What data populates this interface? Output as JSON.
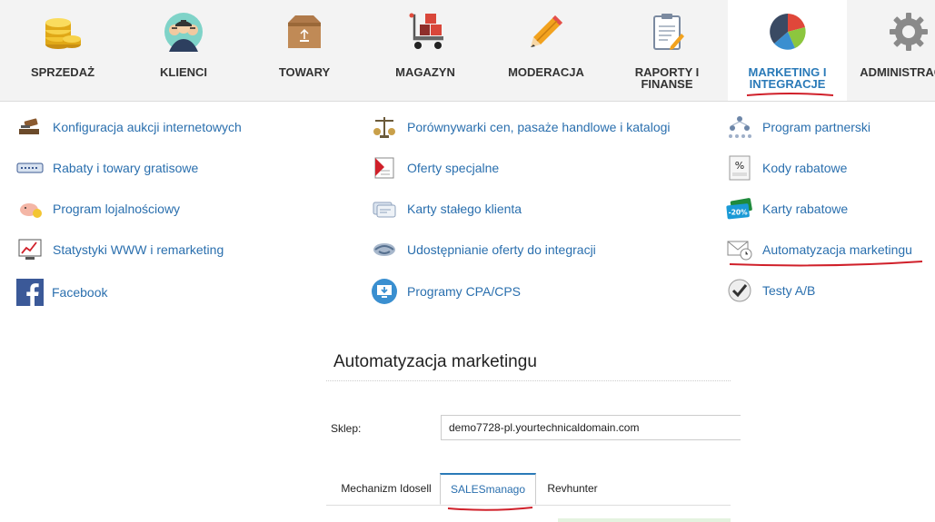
{
  "topnav": {
    "items": [
      {
        "label": "SPRZEDAŻ",
        "icon": "coins-icon"
      },
      {
        "label": "KLIENCI",
        "icon": "people-icon"
      },
      {
        "label": "TOWARY",
        "icon": "box-icon"
      },
      {
        "label": "MAGAZYN",
        "icon": "hand-truck-icon"
      },
      {
        "label": "MODERACJA",
        "icon": "pencil-icon"
      },
      {
        "label_line1": "RAPORTY I",
        "label_line2": "FINANSE",
        "icon": "clipboard-icon"
      },
      {
        "label_line1": "MARKETING I",
        "label_line2": "INTEGRACJE",
        "icon": "pie-chart-icon",
        "active": true
      },
      {
        "label": "ADMINISTRACJA",
        "icon": "gear-icon"
      }
    ]
  },
  "megamenu": {
    "col1": [
      {
        "label": "Konfiguracja aukcji internetowych",
        "icon": "gavel-icon"
      },
      {
        "label": "Rabaty i towary gratisowe",
        "icon": "discount-tag-icon"
      },
      {
        "label": "Program lojalnościowy",
        "icon": "piggy-bank-icon"
      },
      {
        "label": "Statystyki WWW i remarketing",
        "icon": "stats-chart-icon"
      },
      {
        "label": "Facebook",
        "icon": "facebook-icon"
      }
    ],
    "col2": [
      {
        "label": "Porównywarki cen, pasaże handlowe i katalogi",
        "icon": "scales-icon"
      },
      {
        "label": "Oferty specjalne",
        "icon": "special-offer-icon"
      },
      {
        "label": "Karty stałego klienta",
        "icon": "customer-cards-icon"
      },
      {
        "label": "Udostępnianie oferty do integracji",
        "icon": "handshake-icon"
      },
      {
        "label": "Programy CPA/CPS",
        "icon": "cpa-monitor-icon"
      }
    ],
    "col3": [
      {
        "label": "Program partnerski",
        "icon": "partner-network-icon"
      },
      {
        "label": "Kody rabatowe",
        "icon": "percent-code-icon"
      },
      {
        "label": "Karty rabatowe",
        "icon": "discount-card-icon",
        "badge": "-20%"
      },
      {
        "label": "Automatyzacja marketingu",
        "icon": "envelope-clock-icon"
      },
      {
        "label": "Testy A/B",
        "icon": "checkmark-icon"
      }
    ]
  },
  "panel": {
    "title": "Automatyzacja marketingu",
    "shop_label": "Sklep:",
    "shop_value": "demo7728-pl.yourtechnicaldomain.com",
    "tabs": [
      "Mechanizm Idosell",
      "SALESmanago",
      "Revhunter"
    ],
    "active_tab": "SALESmanago"
  },
  "colors": {
    "accent": "#2a7ab8",
    "link": "#2a6fae",
    "annotation": "#d0202a"
  }
}
